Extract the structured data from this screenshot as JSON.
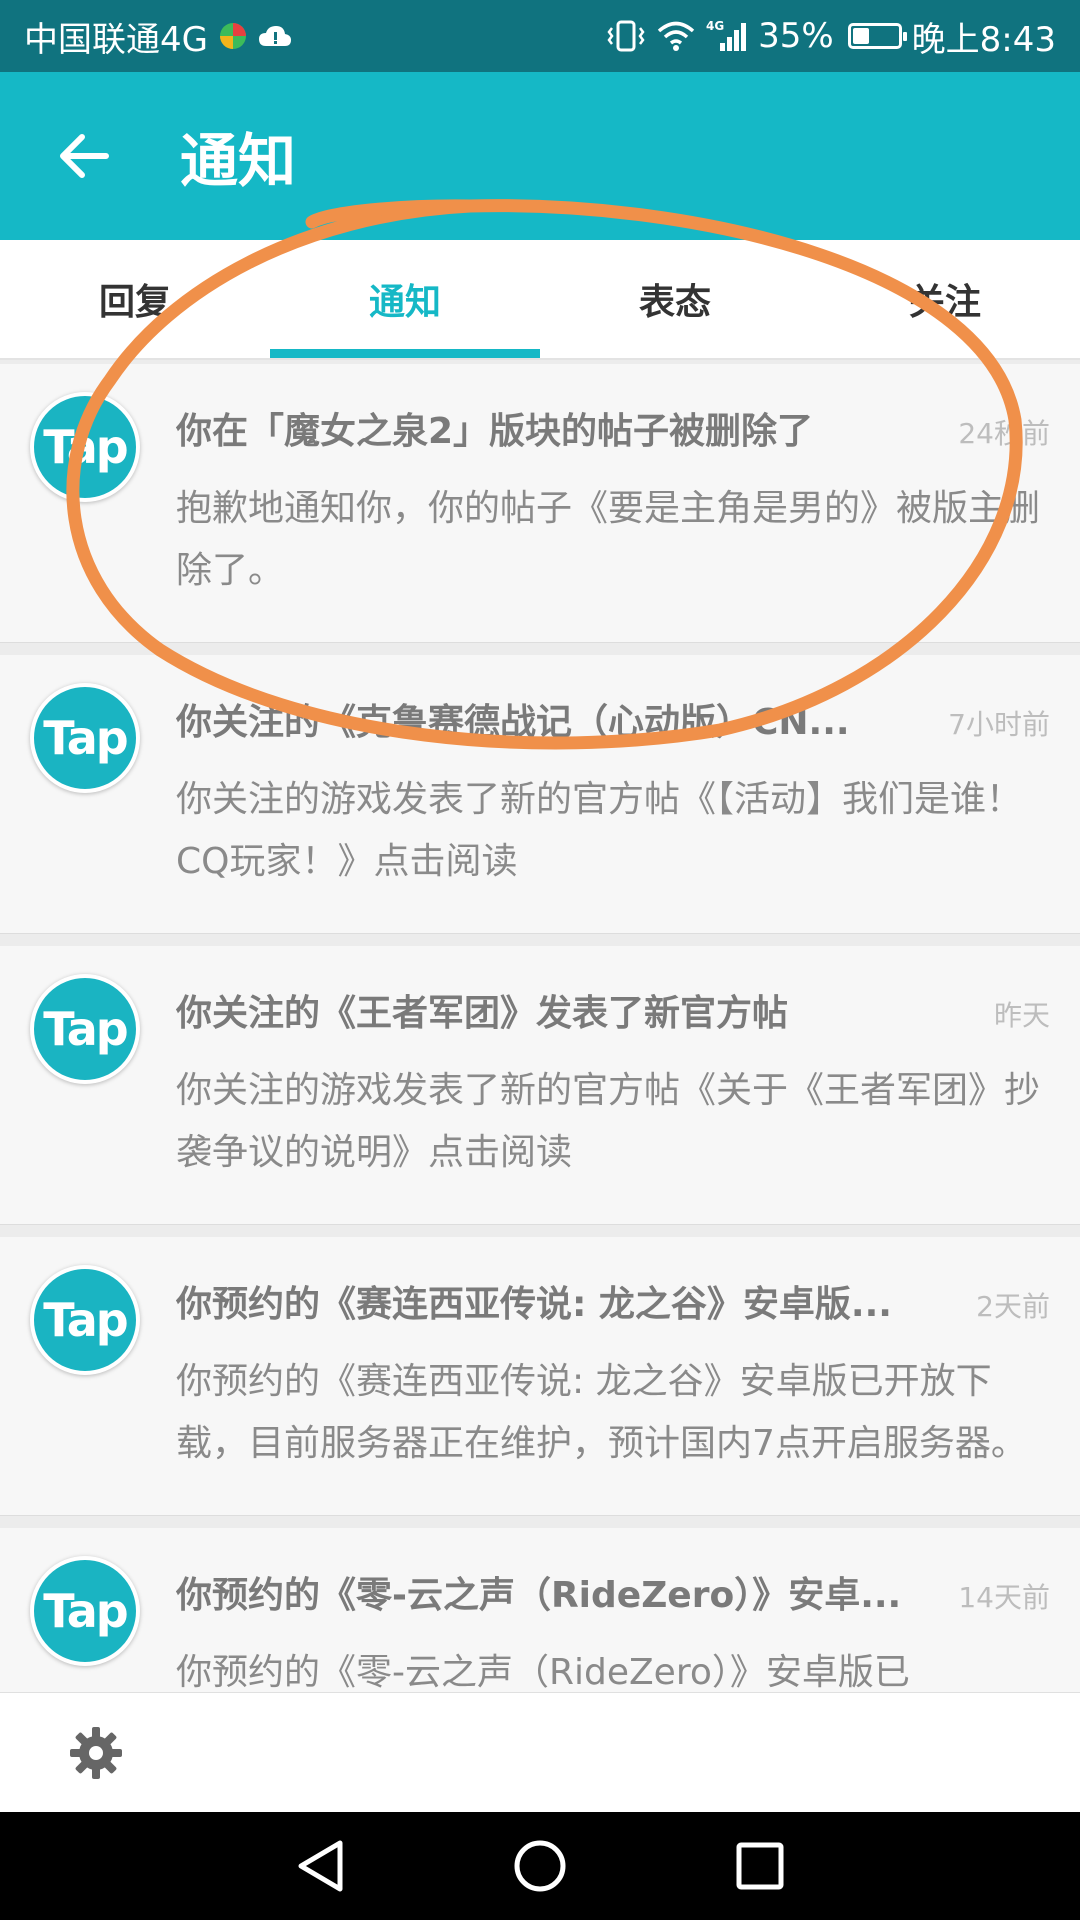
{
  "status_bar": {
    "carrier": "中国联通4G",
    "battery_percent": "35%",
    "battery_level": 0.35,
    "time": "晚上8:43",
    "icons": [
      "app-logo-icon",
      "cloud-icon",
      "vibrate-icon",
      "wifi-icon",
      "signal-icon",
      "battery-icon"
    ]
  },
  "app_bar": {
    "title": "通知",
    "back_icon": "arrow-left-icon"
  },
  "tabs": [
    {
      "label": "回复",
      "active": false
    },
    {
      "label": "通知",
      "active": true
    },
    {
      "label": "表态",
      "active": false
    },
    {
      "label": "关注",
      "active": false
    }
  ],
  "notifications": [
    {
      "avatar": "Tap",
      "title": "你在「魔女之泉2」版块的帖子被删除了",
      "time": "24秒前",
      "body": "抱歉地通知你，你的帖子《要是主角是男的》被版主删除了。"
    },
    {
      "avatar": "Tap",
      "title": "你关注的《克鲁赛德战记（心动版）CN...",
      "time": "7小时前",
      "body": "你关注的游戏发表了新的官方帖《【活动】我们是谁！CQ玩家！》点击阅读"
    },
    {
      "avatar": "Tap",
      "title": "你关注的《王者军团》发表了新官方帖",
      "time": "昨天",
      "body": "你关注的游戏发表了新的官方帖《关于《王者军团》抄袭争议的说明》点击阅读"
    },
    {
      "avatar": "Tap",
      "title": "你预约的《赛连西亚传说: 龙之谷》安卓版...",
      "time": "2天前",
      "body": "你预约的《赛连西亚传说: 龙之谷》安卓版已开放下载，目前服务器正在维护，预计国内7点开启服务器。"
    },
    {
      "avatar": "Tap",
      "title": "你预约的《零-云之声（RideZero）》安卓...",
      "time": "14天前",
      "body": "你预约的《零-云之声（RideZero）》安卓版已"
    }
  ],
  "bottom_bar": {
    "settings_icon": "gear-icon"
  },
  "nav_bar": {
    "icons": [
      "back-triangle-icon",
      "home-circle-icon",
      "recents-square-icon"
    ]
  },
  "colors": {
    "status_bar": "#10737f",
    "accent": "#15b8c6",
    "annotation": "#f0904a"
  }
}
